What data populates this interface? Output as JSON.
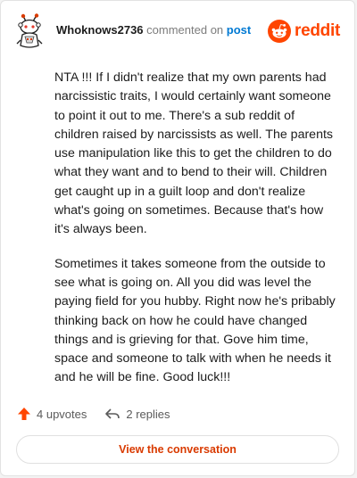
{
  "comment": {
    "username": "Whoknows2736",
    "verb": "commented on",
    "post_link": "post",
    "paragraphs": [
      "NTA !!! If I didn't realize that my own parents had narcissistic traits, I would certainly want someone to point it out to me. There's a sub reddit of children raised by narcissists as well. The parents use manipulation like this to get the children to do what they want and to bend to their will. Children get caught up in a guilt loop and don't realize what's going on sometimes. Because that's how it's always been.",
      "Sometimes it takes someone from the outside to see what is going on. All you did was level the paying field for you hubby. Right now he's pribably thinking back on how he could have changed things and is grieving for that. Gove him time, space and someone to talk with when he needs it and he will be fine. Good luck!!!"
    ]
  },
  "brand": {
    "wordmark": "reddit",
    "icon": "reddit-logo-icon",
    "color": "#ff4500"
  },
  "actions": {
    "upvotes": "4 upvotes",
    "replies": "2 replies",
    "upvote_icon": "upvote-arrow-icon",
    "reply_icon": "reply-arrow-icon"
  },
  "cta": {
    "label": "View the conversation"
  },
  "colors": {
    "accent": "#ff4500",
    "link": "#0079d3",
    "cta_text": "#d93a00"
  }
}
